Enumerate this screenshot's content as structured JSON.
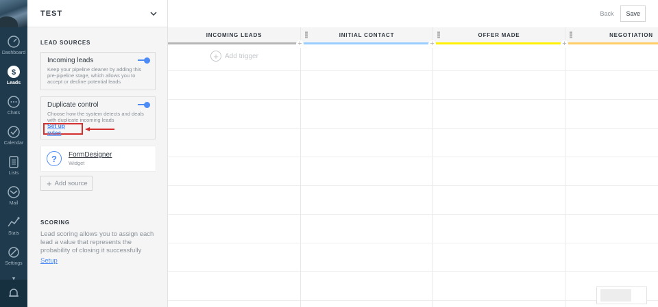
{
  "nav": {
    "items": [
      {
        "label": "Dashboard",
        "icon": "dashboard-icon"
      },
      {
        "label": "Leads",
        "icon": "leads-icon",
        "active": true
      },
      {
        "label": "Chats",
        "icon": "chats-icon"
      },
      {
        "label": "Calendar",
        "icon": "calendar-icon"
      },
      {
        "label": "Lists",
        "icon": "lists-icon"
      },
      {
        "label": "Mail",
        "icon": "mail-icon"
      },
      {
        "label": "Stats",
        "icon": "stats-icon"
      },
      {
        "label": "Settings",
        "icon": "settings-icon"
      }
    ]
  },
  "panel": {
    "title": "TEST",
    "lead_sources_title": "LEAD SOURCES",
    "incoming": {
      "title": "Incoming leads",
      "desc": "Keep your pipeline cleaner by adding this pre-pipeline stage, which allows you to accept or decline potential leads",
      "enabled": true
    },
    "duplicate": {
      "title": "Duplicate control",
      "desc": "Choose how the system detects and deals with duplicate incoming leads",
      "link": "Set up rules",
      "enabled": true
    },
    "widget": {
      "icon": "?",
      "name": "FormDesigner",
      "type": "Widget"
    },
    "add_source": "Add source",
    "scoring_title": "SCORING",
    "scoring_desc": "Lead scoring allows you to assign each lead a value that represents the probability of closing it successfully",
    "scoring_link": "Setup"
  },
  "topbar": {
    "back": "Back",
    "save": "Save"
  },
  "pipeline": {
    "columns": [
      {
        "label": "INCOMING LEADS",
        "color": "#b5b5b5"
      },
      {
        "label": "INITIAL CONTACT",
        "color": "#99ccff"
      },
      {
        "label": "OFFER MADE",
        "color": "#fff000"
      },
      {
        "label": "NEGOTIATION",
        "color": "#ffcc66"
      }
    ],
    "add_trigger": "Add trigger"
  },
  "colors": {
    "accent": "#4c8bf5",
    "highlight": "#d32f2f",
    "nav_bg": "#1f3a4d"
  }
}
